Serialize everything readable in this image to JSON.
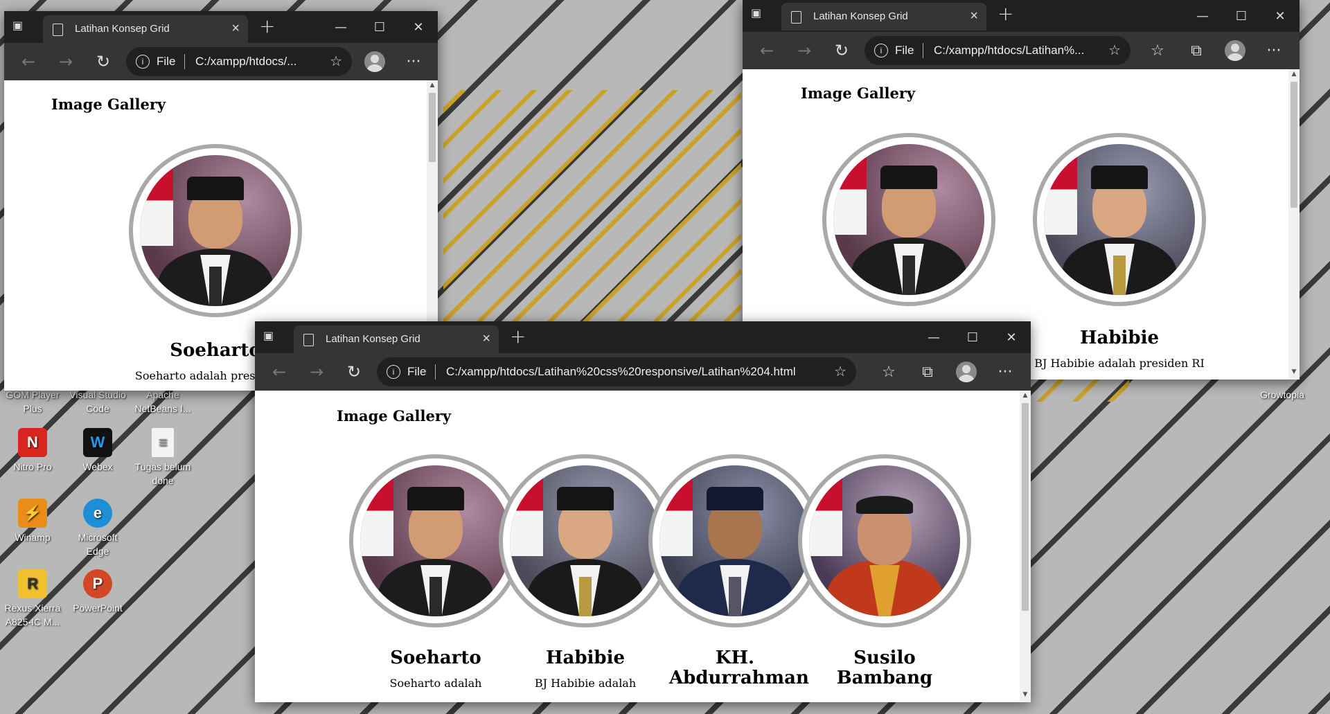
{
  "desktop": {
    "icons": [
      {
        "label": "GOM Player Plus"
      },
      {
        "label": "Visual Studio Code"
      },
      {
        "label": "Apache NetBeans I..."
      },
      {
        "label": "Nitro Pro"
      },
      {
        "label": "Webex"
      },
      {
        "label": "Tugas belum done"
      },
      {
        "label": "Winamp"
      },
      {
        "label": "Microsoft Edge"
      },
      {
        "label": "Rexus Xierra A825-IC M..."
      },
      {
        "label": "PowerPoint"
      },
      {
        "label": "Growtopia"
      }
    ]
  },
  "browser": {
    "tab_title": "Latihan Konsep Grid",
    "address_scheme": "File",
    "new_tab": "+",
    "menu_dots": "···"
  },
  "windows": [
    {
      "url": "C:/xampp/htdocs/..."
    },
    {
      "url": "C:/xampp/htdocs/Latihan%..."
    },
    {
      "url": "C:/xampp/htdocs/Latihan%20css%20responsive/Latihan%204.html"
    }
  ],
  "page": {
    "title": "Image Gallery",
    "people": [
      {
        "name": "Soeharto",
        "desc": "Soeharto adalah presiden RI",
        "desc_short": "Soeharto adalah"
      },
      {
        "name": "Habibie",
        "desc": "BJ Habibie adalah presiden RI",
        "desc_short": "BJ Habibie adalah"
      },
      {
        "name": "KH. Abdurrahman",
        "desc": ""
      },
      {
        "name": "Susilo Bambang",
        "desc": ""
      }
    ]
  }
}
